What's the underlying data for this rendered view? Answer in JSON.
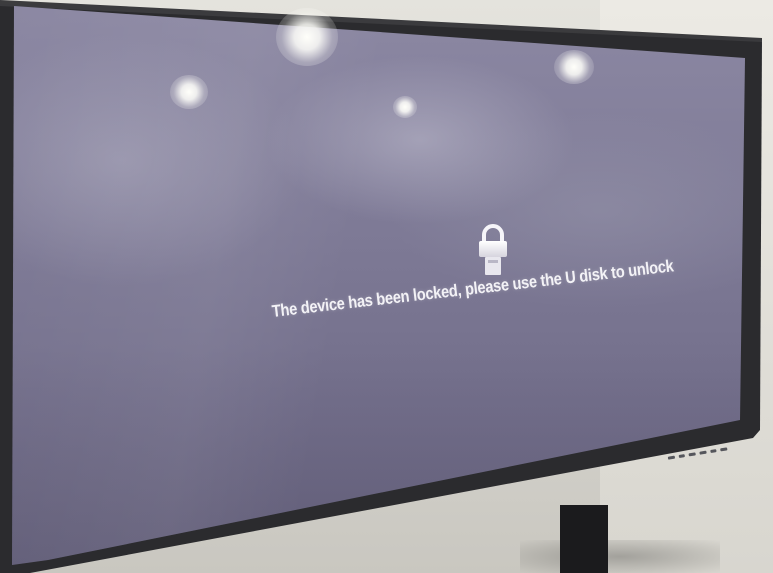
{
  "screen": {
    "lock_icon": "lock-icon",
    "message": "The device has been locked, please use the U disk to unlock"
  }
}
